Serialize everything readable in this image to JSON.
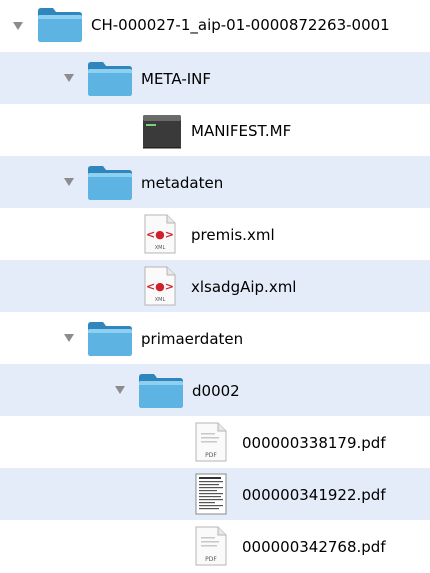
{
  "tree": {
    "root": {
      "label": "CH-000027-1_aip-01-0000872263-0001",
      "icon": "folder-icon"
    },
    "meta_inf": {
      "label": "META-INF",
      "icon": "folder-icon"
    },
    "manifest": {
      "label": "MANIFEST.MF",
      "icon": "terminal-file-icon"
    },
    "metadaten": {
      "label": "metadaten",
      "icon": "folder-icon"
    },
    "premis": {
      "label": "premis.xml",
      "icon": "xml-file-icon",
      "badge": "XML"
    },
    "xlsadg": {
      "label": "xlsadgAip.xml",
      "icon": "xml-file-icon",
      "badge": "XML"
    },
    "primaerdaten": {
      "label": "primaerdaten",
      "icon": "folder-icon"
    },
    "d0002": {
      "label": "d0002",
      "icon": "folder-icon"
    },
    "pdf1": {
      "label": "000000338179.pdf",
      "icon": "pdf-file-icon",
      "badge": "PDF"
    },
    "pdf2": {
      "label": "000000341922.pdf",
      "icon": "document-preview-icon"
    },
    "pdf3": {
      "label": "000000342768.pdf",
      "icon": "pdf-file-icon",
      "badge": "PDF"
    }
  },
  "colors": {
    "folder": "#4fa8d8",
    "row_alt": "#e3ecf8",
    "disclosure": "#8c8c8c",
    "xml_accent": "#d0202a"
  }
}
